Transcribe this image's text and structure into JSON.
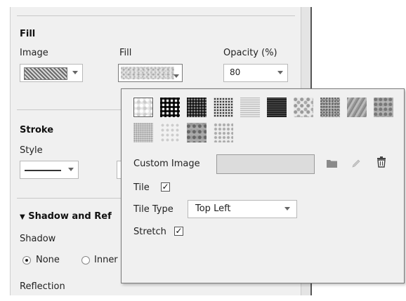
{
  "fill": {
    "section_title": "Fill",
    "image_label": "Image",
    "fill_label": "Fill",
    "opacity_label": "Opacity (%)",
    "opacity_value": "80"
  },
  "stroke": {
    "section_title": "Stroke",
    "style_label": "Style"
  },
  "shadow": {
    "section_title": "Shadow and Ref",
    "section_arrow": "▼",
    "shadow_label": "Shadow",
    "option_none": "None",
    "option_inner": "Inner",
    "reflection_label": "Reflection"
  },
  "popup": {
    "textures": [
      "marble",
      "grid-dark",
      "grid-mid",
      "dots",
      "hlines",
      "dark-lines",
      "floral",
      "granite",
      "wood",
      "stone",
      "sand",
      "light",
      "rock",
      "lace"
    ],
    "custom_image_label": "Custom Image",
    "tile_label": "Tile",
    "tile_checked": "✓",
    "tile_type_label": "Tile Type",
    "tile_type_value": "Top Left",
    "stretch_label": "Stretch",
    "stretch_checked": "✓"
  }
}
